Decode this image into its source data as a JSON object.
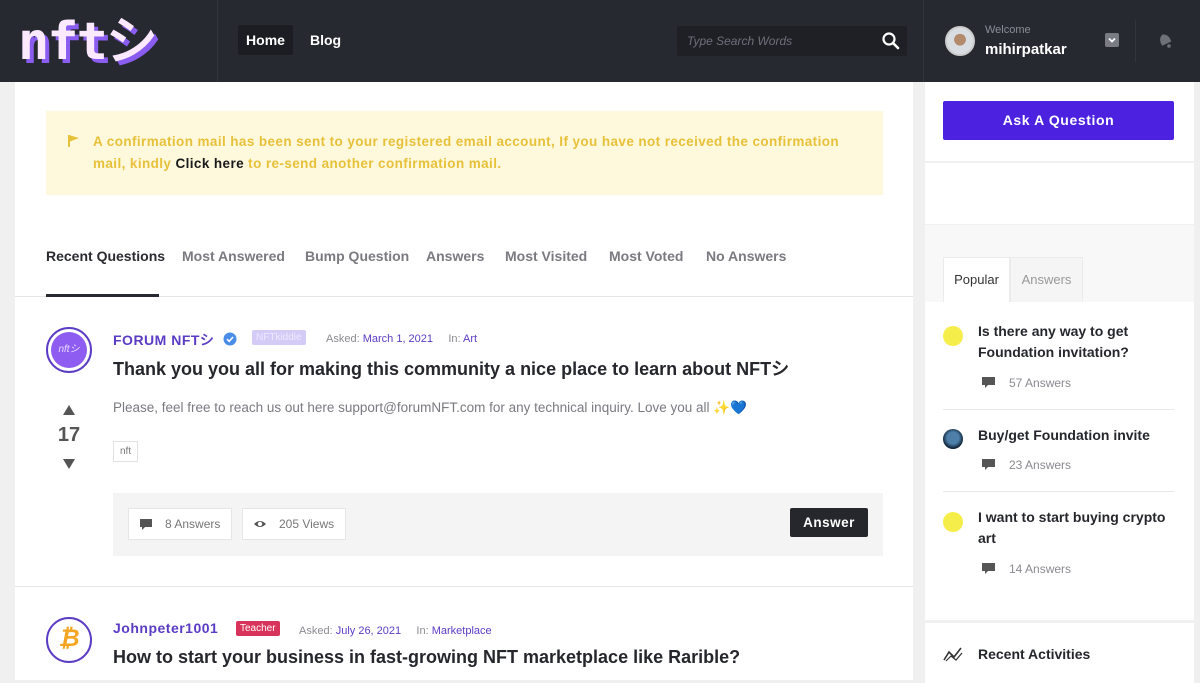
{
  "header": {
    "logo_text": "nftシ",
    "nav": [
      {
        "label": "Home",
        "active": true
      },
      {
        "label": "Blog",
        "active": false
      }
    ],
    "search": {
      "placeholder": "Type Search Words",
      "value": ""
    },
    "user": {
      "welcome": "Welcome",
      "name": "mihirpatkar"
    }
  },
  "alert": {
    "text_before": "A confirmation mail has been sent to your registered email account, If you have not received the confirmation mail, kindly ",
    "link": "Click here",
    "text_after": " to re-send another confirmation mail."
  },
  "tabs": [
    {
      "label": "Recent Questions",
      "active": true
    },
    {
      "label": "Most Answered",
      "active": false
    },
    {
      "label": "Bump Question",
      "active": false
    },
    {
      "label": "Answers",
      "active": false
    },
    {
      "label": "Most Visited",
      "active": false
    },
    {
      "label": "Most Voted",
      "active": false
    },
    {
      "label": "No Answers",
      "active": false
    }
  ],
  "questions": [
    {
      "author": "FORUM NFTシ",
      "verified": true,
      "badge": "NFTkiddie",
      "asked_label": "Asked:",
      "date": "March 1, 2021",
      "in_label": "In:",
      "category": "Art",
      "title": "Thank you you all for making this community a nice place to learn about NFTシ",
      "excerpt": "Please, feel free to reach us out here support@forumNFT.com for any technical inquiry. Love you all ✨💙",
      "votes": "17",
      "tags": [
        "nft"
      ],
      "answers": "8 Answers",
      "views": "205 Views",
      "answer_button": "Answer"
    },
    {
      "author": "Johnpeter1001",
      "badge": "Teacher",
      "asked_label": "Asked:",
      "date": "July 26, 2021",
      "in_label": "In:",
      "category": "Marketplace",
      "title": "How to start your business in fast-growing NFT marketplace like Rarible?"
    }
  ],
  "sidebar": {
    "ask_button": "Ask A Question",
    "widget_tabs": [
      {
        "label": "Popular",
        "active": true
      },
      {
        "label": "Answers",
        "active": false
      }
    ],
    "popular": [
      {
        "title": "Is there any way to get Foundation invitation?",
        "answers": "57 Answers"
      },
      {
        "title": "Buy/get Foundation invite",
        "answers": "23 Answers"
      },
      {
        "title": "I want to start buying crypto art",
        "answers": "14 Answers"
      }
    ],
    "recent_activities": "Recent Activities"
  },
  "colors": {
    "accent": "#4c22e0",
    "author": "#5b3cc4",
    "topbar": "#272930",
    "alert_bg": "#fef9dc",
    "alert_text": "#e8c13a",
    "badge_nftkiddie": "#d4ccf7",
    "badge_teacher": "#d8335a"
  }
}
